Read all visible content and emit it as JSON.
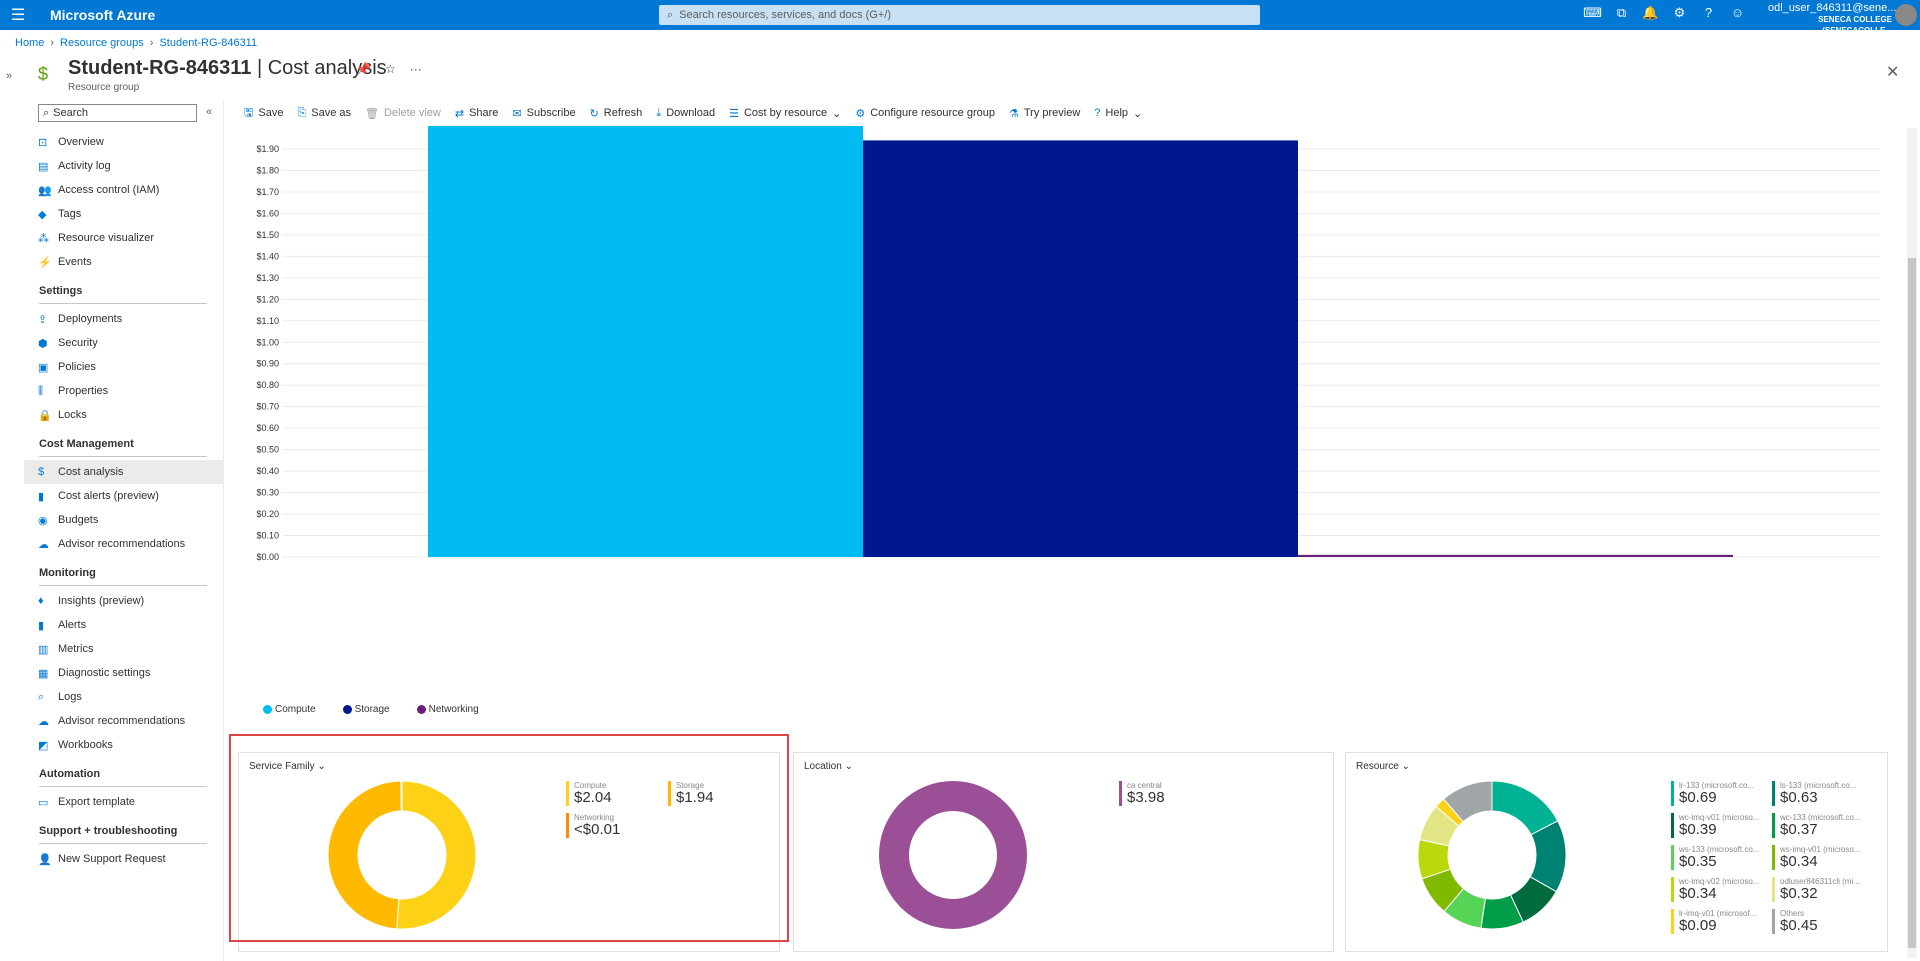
{
  "topbar": {
    "brand": "Microsoft Azure",
    "search_placeholder": "Search resources, services, and docs (G+/)",
    "user_name": "odl_user_846311@sene...",
    "user_org": "SENECA COLLEGE (SENECACOLLE..."
  },
  "breadcrumb": [
    "Home",
    "Resource groups",
    "Student-RG-846311"
  ],
  "page": {
    "title_bold": "Student-RG-846311",
    "title_rest": " | Cost analysis",
    "subtitle": "Resource group"
  },
  "sidebar": {
    "search_placeholder": "Search",
    "items": [
      {
        "label": "Overview",
        "icon": "overview-icon",
        "glyph": "⊡"
      },
      {
        "label": "Activity log",
        "icon": "activity-log-icon",
        "glyph": "▤"
      },
      {
        "label": "Access control (IAM)",
        "icon": "iam-icon",
        "glyph": "👥"
      },
      {
        "label": "Tags",
        "icon": "tag-icon",
        "glyph": "◆"
      },
      {
        "label": "Resource visualizer",
        "icon": "visualizer-icon",
        "glyph": "⁂"
      },
      {
        "label": "Events",
        "icon": "events-icon",
        "glyph": "⚡"
      }
    ],
    "settings_header": "Settings",
    "settings": [
      {
        "label": "Deployments",
        "icon": "deployments-icon",
        "glyph": "⇪"
      },
      {
        "label": "Security",
        "icon": "security-icon",
        "glyph": "⬢"
      },
      {
        "label": "Policies",
        "icon": "policies-icon",
        "glyph": "▣"
      },
      {
        "label": "Properties",
        "icon": "properties-icon",
        "glyph": "⫼"
      },
      {
        "label": "Locks",
        "icon": "lock-icon",
        "glyph": "🔒"
      }
    ],
    "cost_header": "Cost Management",
    "cost": [
      {
        "label": "Cost analysis",
        "icon": "cost-analysis-icon",
        "glyph": "$"
      },
      {
        "label": "Cost alerts (preview)",
        "icon": "cost-alerts-icon",
        "glyph": "▮"
      },
      {
        "label": "Budgets",
        "icon": "budgets-icon",
        "glyph": "◉"
      },
      {
        "label": "Advisor recommendations",
        "icon": "advisor-icon",
        "glyph": "☁"
      }
    ],
    "monitoring_header": "Monitoring",
    "monitoring": [
      {
        "label": "Insights (preview)",
        "icon": "insights-icon",
        "glyph": "♦"
      },
      {
        "label": "Alerts",
        "icon": "alerts-icon",
        "glyph": "▮"
      },
      {
        "label": "Metrics",
        "icon": "metrics-icon",
        "glyph": "▥"
      },
      {
        "label": "Diagnostic settings",
        "icon": "diagnostic-icon",
        "glyph": "▦"
      },
      {
        "label": "Logs",
        "icon": "logs-icon",
        "glyph": "⌕"
      },
      {
        "label": "Advisor recommendations",
        "icon": "advisor-icon",
        "glyph": "☁"
      },
      {
        "label": "Workbooks",
        "icon": "workbooks-icon",
        "glyph": "◩"
      }
    ],
    "automation_header": "Automation",
    "automation": [
      {
        "label": "Export template",
        "icon": "export-template-icon",
        "glyph": "▭"
      }
    ],
    "support_header": "Support + troubleshooting",
    "support": [
      {
        "label": "New Support Request",
        "icon": "support-icon",
        "glyph": "👤"
      }
    ]
  },
  "toolbar": [
    {
      "label": "Save",
      "icon": "save-icon",
      "glyph": "🖫",
      "disabled": false
    },
    {
      "label": "Save as",
      "icon": "save-as-icon",
      "glyph": "⎘",
      "disabled": false
    },
    {
      "label": "Delete view",
      "icon": "delete-icon",
      "glyph": "🗑",
      "disabled": true
    },
    {
      "label": "Share",
      "icon": "share-icon",
      "glyph": "⇄",
      "disabled": false
    },
    {
      "label": "Subscribe",
      "icon": "subscribe-icon",
      "glyph": "✉",
      "disabled": false
    },
    {
      "label": "Refresh",
      "icon": "refresh-icon",
      "glyph": "↻",
      "disabled": false
    },
    {
      "label": "Download",
      "icon": "download-icon",
      "glyph": "⤓",
      "disabled": false
    },
    {
      "label": "Cost by resource",
      "icon": "list-icon",
      "glyph": "☰",
      "disabled": false,
      "dropdown": true
    },
    {
      "label": "Configure resource group",
      "icon": "gear-icon",
      "glyph": "⚙",
      "disabled": false
    },
    {
      "label": "Try preview",
      "icon": "flask-icon",
      "glyph": "⚗",
      "disabled": false
    },
    {
      "label": "Help",
      "icon": "help-icon",
      "glyph": "?",
      "disabled": false,
      "dropdown": true
    }
  ],
  "chart_data": {
    "type": "bar",
    "categories": [
      "Compute",
      "Storage",
      "Networking"
    ],
    "values": [
      2.04,
      1.94,
      0.01
    ],
    "colors": [
      "#00bcf2",
      "#00188f",
      "#68217a"
    ],
    "ylim": [
      0,
      1.9
    ],
    "ytick_step": 0.1,
    "ytick_labels": [
      "$0.00",
      "$0.10",
      "$0.20",
      "$0.30",
      "$0.40",
      "$0.50",
      "$0.60",
      "$0.70",
      "$0.80",
      "$0.90",
      "$1.00",
      "$1.10",
      "$1.20",
      "$1.30",
      "$1.40",
      "$1.50",
      "$1.60",
      "$1.70",
      "$1.80",
      "$1.90"
    ],
    "legend": [
      "Compute",
      "Storage",
      "Networking"
    ],
    "grid": true
  },
  "cards": {
    "service_family": {
      "header": "Service Family",
      "items": [
        {
          "name": "Compute",
          "value": "$2.04",
          "color": "#fcd116"
        },
        {
          "name": "Storage",
          "value": "$1.94",
          "color": "#ffb900"
        },
        {
          "name": "Networking",
          "value": "<$0.01",
          "color": "#ff8c00"
        }
      ],
      "donut": [
        2.04,
        1.94,
        0.01
      ],
      "donut_colors": [
        "#fcd116",
        "#ffb900",
        "#ff8c00"
      ]
    },
    "location": {
      "header": "Location",
      "items": [
        {
          "name": "ca central",
          "value": "$3.98",
          "color": "#9b4f96"
        }
      ],
      "donut": [
        3.98
      ],
      "donut_colors": [
        "#9b4f96"
      ]
    },
    "resource": {
      "header": "Resource",
      "items": [
        {
          "name": "lr-133 (microsoft.co...",
          "value": "$0.69",
          "color": "#00b294"
        },
        {
          "name": "ls-133 (microsoft.co...",
          "value": "$0.63",
          "color": "#008272"
        },
        {
          "name": "wc-imq-v01 (microso...",
          "value": "$0.39",
          "color": "#006b3f"
        },
        {
          "name": "wc-133 (microsoft.co...",
          "value": "$0.37",
          "color": "#009e49"
        },
        {
          "name": "ws-133 (microsoft.co...",
          "value": "$0.35",
          "color": "#55d455"
        },
        {
          "name": "ws-imq-v01 (microso...",
          "value": "$0.34",
          "color": "#7fba00"
        },
        {
          "name": "wc-imq-v02 (microso...",
          "value": "$0.34",
          "color": "#bad80a"
        },
        {
          "name": "odluser846311cli (mi...",
          "value": "$0.32",
          "color": "#e2e584"
        },
        {
          "name": "lr-imq-v01 (microsof...",
          "value": "$0.09",
          "color": "#fcd116"
        },
        {
          "name": "Others",
          "value": "$0.45",
          "color": "#a0a5a8"
        }
      ],
      "donut": [
        0.69,
        0.63,
        0.39,
        0.37,
        0.35,
        0.34,
        0.34,
        0.32,
        0.09,
        0.45
      ],
      "donut_colors": [
        "#00b294",
        "#008272",
        "#006b3f",
        "#009e49",
        "#55d455",
        "#7fba00",
        "#bad80a",
        "#e2e584",
        "#fcd116",
        "#a0a5a8"
      ]
    }
  }
}
